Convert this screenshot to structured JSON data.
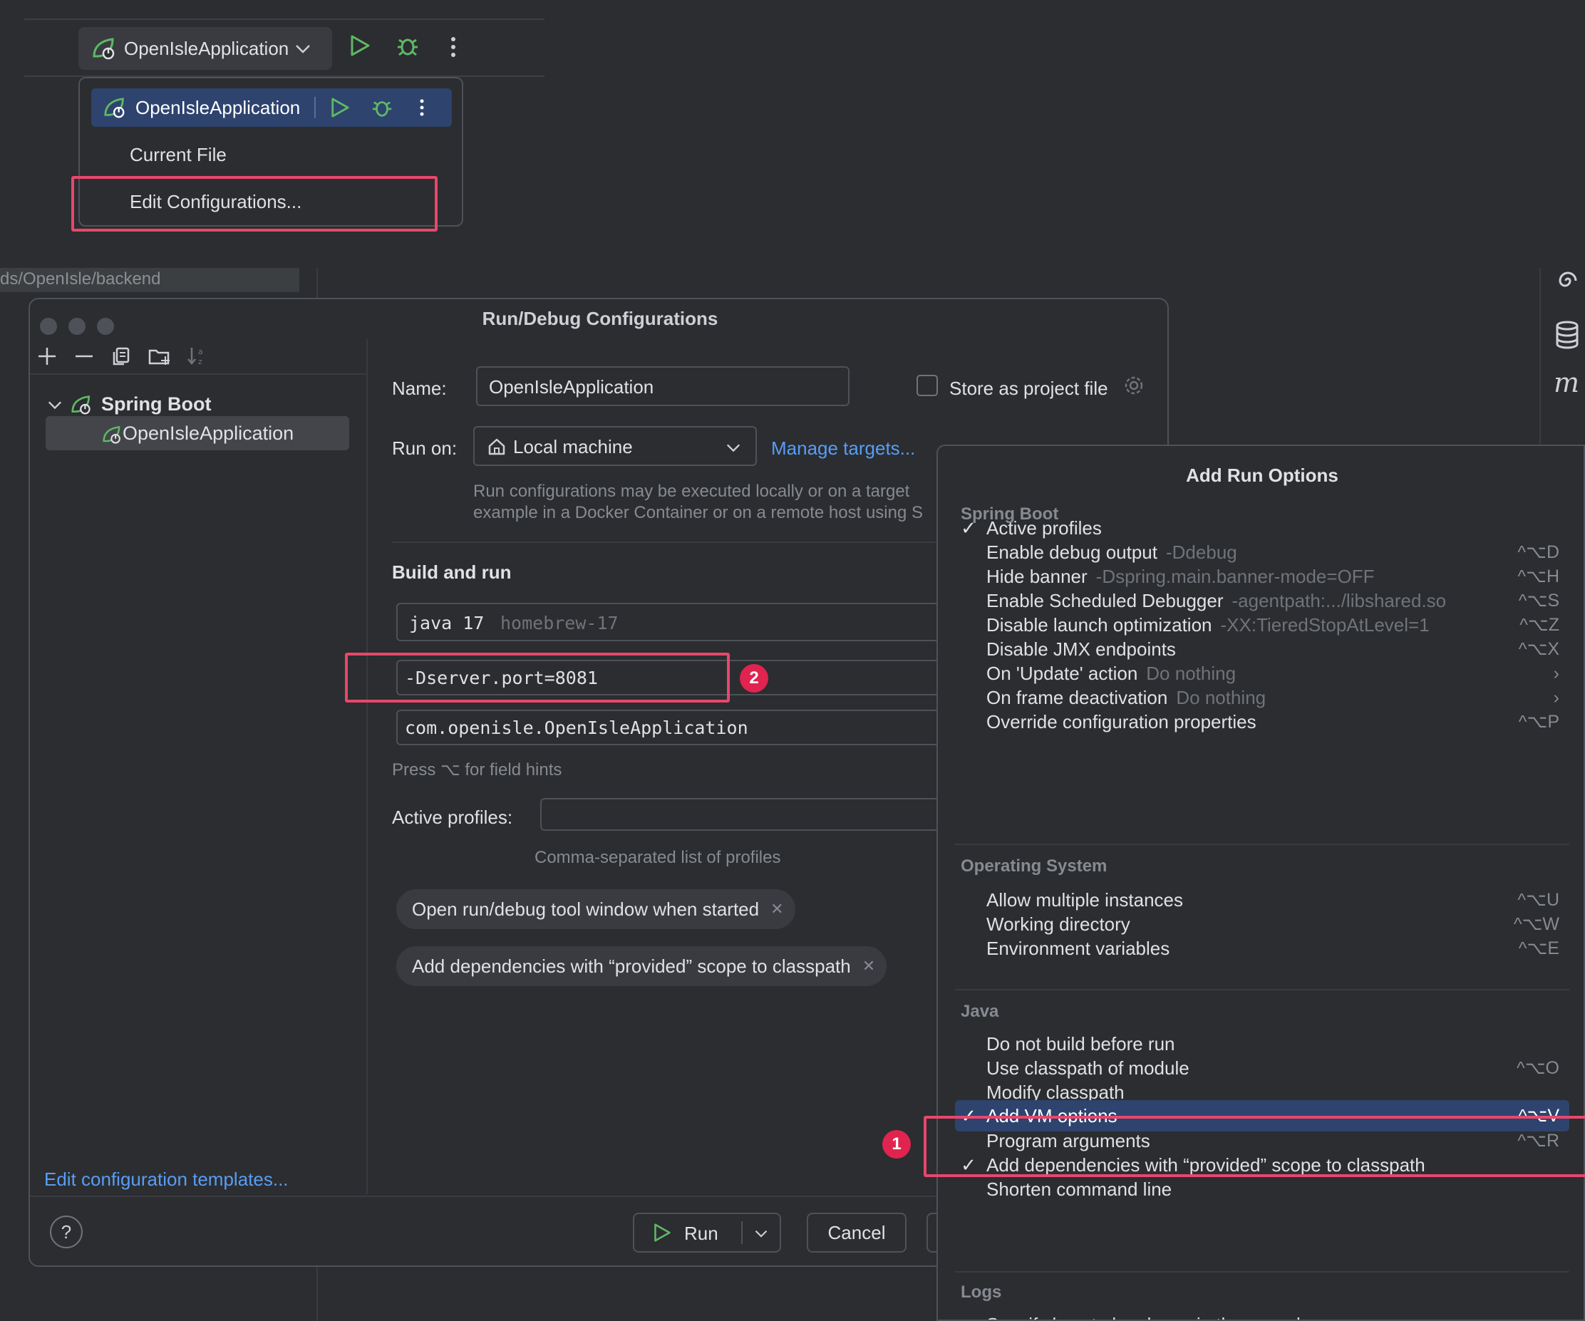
{
  "toolbar": {
    "run_config": "OpenIsleApplication"
  },
  "run_popup": {
    "selected": "OpenIsleApplication",
    "items": [
      "Current File",
      "Edit Configurations..."
    ]
  },
  "background": {
    "path_fragment": "ds/OpenIsle/backend"
  },
  "dialog": {
    "title": "Run/Debug Configurations",
    "tree": {
      "group": "Spring Boot",
      "item": "OpenIsleApplication"
    },
    "edit_templates_link": "Edit configuration templates...",
    "name_label": "Name:",
    "name_value": "OpenIsleApplication",
    "store_label": "Store as project file",
    "run_on_label": "Run on:",
    "run_on_value": "Local machine",
    "manage_targets": "Manage targets...",
    "run_on_hint_1": "Run configurations may be executed locally or on a target",
    "run_on_hint_2": "example in a Docker Container or on a remote host using S",
    "build_and_run": "Build and run",
    "jdk_value": "java 17",
    "jdk_hint": "homebrew-17",
    "vm_options": "-Dserver.port=8081",
    "main_class": "com.openisle.OpenIsleApplication",
    "field_hints": "Press ⌥ for field hints",
    "active_profiles_label": "Active profiles:",
    "active_profiles_hint": "Comma-separated list of profiles",
    "chips": [
      "Open run/debug tool window when started",
      "Add dependencies with “provided” scope to classpath"
    ],
    "run_button": "Run",
    "cancel_button": "Cancel",
    "help": "?"
  },
  "options": {
    "title": "Add Run Options",
    "groups": {
      "spring_boot": "Spring Boot",
      "operating_system": "Operating System",
      "java": "Java",
      "logs": "Logs"
    },
    "spring_items": [
      {
        "label": "Active profiles",
        "hint": "",
        "shortcut": "",
        "checked": "✓"
      },
      {
        "label": "Enable debug output",
        "hint": "-Ddebug",
        "shortcut": "^⌥D",
        "checked": ""
      },
      {
        "label": "Hide banner",
        "hint": "-Dspring.main.banner-mode=OFF",
        "shortcut": "^⌥H",
        "checked": ""
      },
      {
        "label": "Enable Scheduled Debugger",
        "hint": "-agentpath:.../libshared.so",
        "shortcut": "^⌥S",
        "checked": ""
      },
      {
        "label": "Disable launch optimization",
        "hint": "-XX:TieredStopAtLevel=1",
        "shortcut": "^⌥Z",
        "checked": ""
      },
      {
        "label": "Disable JMX endpoints",
        "hint": "",
        "shortcut": "^⌥X",
        "checked": ""
      },
      {
        "label": "On 'Update' action",
        "hint": "Do nothing",
        "shortcut": "›",
        "checked": ""
      },
      {
        "label": "On frame deactivation",
        "hint": "Do nothing",
        "shortcut": "›",
        "checked": ""
      },
      {
        "label": "Override configuration properties",
        "hint": "",
        "shortcut": "^⌥P",
        "checked": ""
      }
    ],
    "os_items": [
      {
        "label": "Allow multiple instances",
        "shortcut": "^⌥U"
      },
      {
        "label": "Working directory",
        "shortcut": "^⌥W"
      },
      {
        "label": "Environment variables",
        "shortcut": "^⌥E"
      }
    ],
    "java_items": [
      {
        "label": "Do not build before run",
        "shortcut": "",
        "checked": ""
      },
      {
        "label": "Use classpath of module",
        "shortcut": "^⌥O",
        "checked": ""
      },
      {
        "label": "Modify classpath",
        "shortcut": "",
        "checked": ""
      },
      {
        "label": "Add VM options",
        "shortcut": "^⌥V",
        "checked": "✓"
      },
      {
        "label": "Program arguments",
        "shortcut": "^⌥R",
        "checked": ""
      },
      {
        "label": "Add dependencies with “provided” scope to classpath",
        "shortcut": "",
        "checked": "✓"
      },
      {
        "label": "Shorten command line",
        "shortcut": "",
        "checked": ""
      }
    ],
    "logs_item": "Specify logs to be shown in the console"
  },
  "annotations": {
    "badge_1": "1",
    "badge_2": "2"
  },
  "colors": {
    "accent": "#e8476d",
    "selection": "#2e436e",
    "link": "#589df6",
    "run_green": "#5fb865"
  }
}
